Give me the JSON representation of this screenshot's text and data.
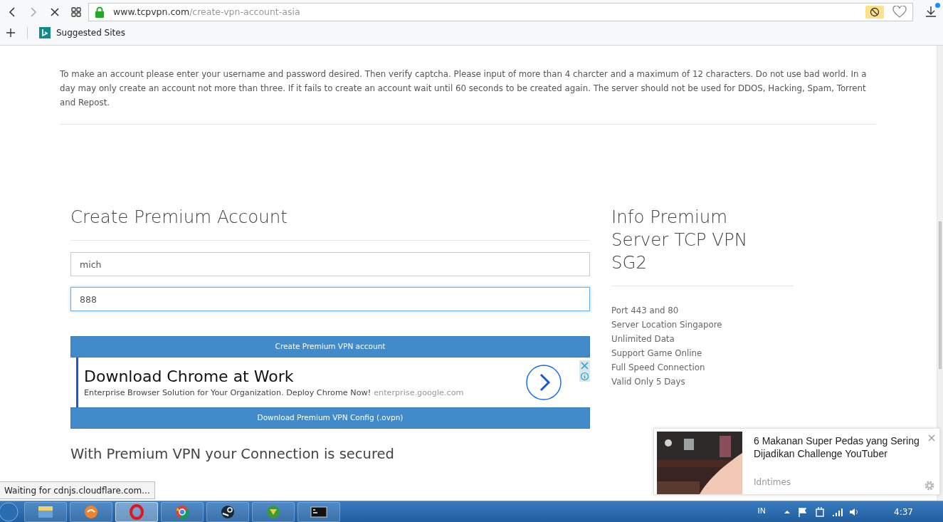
{
  "browser": {
    "url_host": "www.tcpvpn.com",
    "url_path": "/create-vpn-account-asia",
    "bookmarks": [
      {
        "label": "Suggested Sites"
      }
    ],
    "download_badge": true
  },
  "notice": "To make an account please enter your username and password desired. Then verify captcha. Please input of more than 4 charcter and a maximum of 12 characters. Do not use bad world. In a day may only create an account not more than three. If it fails to create an account wait until 60 seconds to be created again. The server should not be used for DDOS, Hacking, Spam, Torrent and Repost.",
  "form": {
    "title": "Create Premium Account",
    "fields": [
      {
        "value": "mich",
        "focused": false
      },
      {
        "value": "888",
        "focused": true
      }
    ],
    "create_button": "Create Premium VPN account",
    "ad": {
      "title": "Download Chrome at Work",
      "text": "Enterprise Browser Solution for Your Organization. Deploy Chrome Now!",
      "domain": "enterprise.google.com"
    },
    "download_button": "Download Premium VPN Config (.ovpn)",
    "section_title": "With Premium VPN your Connection is secured"
  },
  "info": {
    "title": "Info Premium Server TCP VPN SG2",
    "items": [
      "Port 443 and 80",
      "Server Location Singapore",
      "Unlimited Data",
      "Support Game Online",
      "Full Speed Connection",
      "Valid Only 5 Days"
    ]
  },
  "popup": {
    "title": "6 Makanan Super Pedas yang Sering Dijadikan Challenge YouTuber",
    "source": "Idntimes"
  },
  "status_text": "Waiting for cdnjs.cloudflare.com...",
  "taskbar": {
    "apps": [
      {
        "selected": false
      },
      {
        "selected": false
      },
      {
        "selected": true
      },
      {
        "selected": false
      },
      {
        "selected": false
      },
      {
        "selected": false
      },
      {
        "selected": false
      }
    ],
    "language": "IN",
    "time": "4:37"
  }
}
